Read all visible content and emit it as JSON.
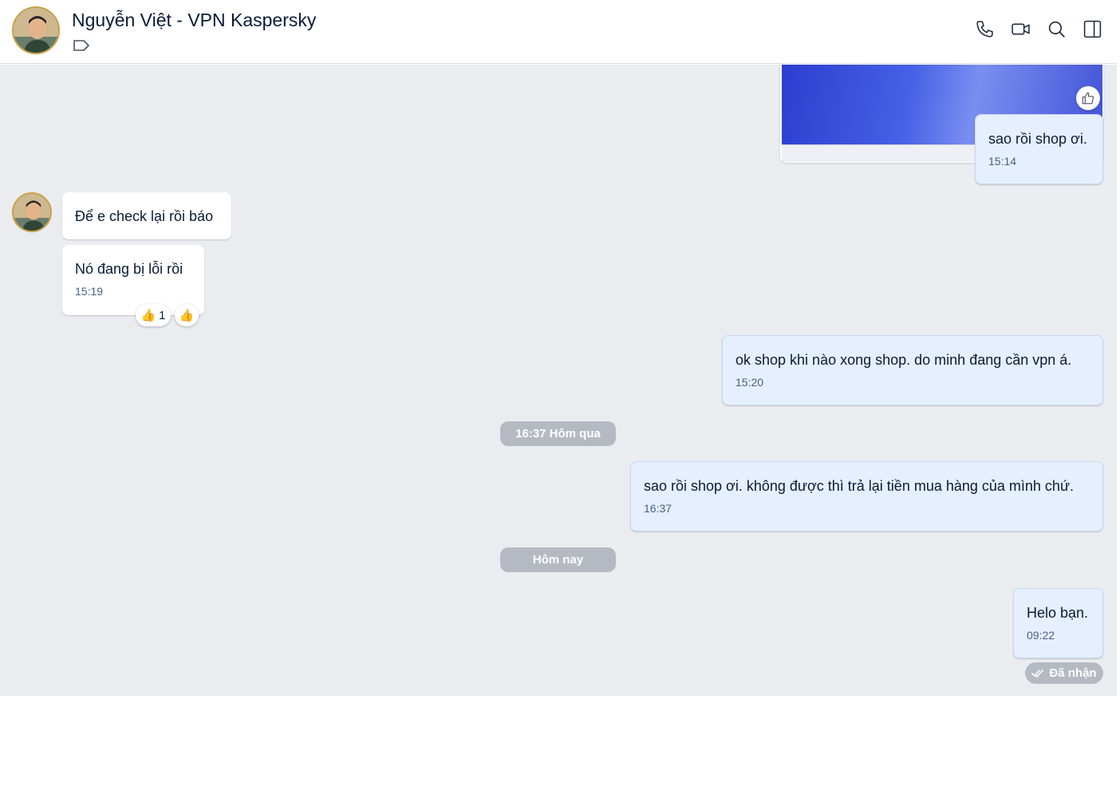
{
  "header": {
    "contact_name": "Nguyễn Việt - VPN Kaspersky",
    "icons": [
      "tag-icon",
      "phone-icon",
      "video-call-icon",
      "search-icon",
      "sidebar-toggle-icon"
    ]
  },
  "messages": [
    {
      "from": "me",
      "type": "image",
      "reaction_icon": "thumbs-up-icon"
    },
    {
      "from": "me",
      "text": "sao rồi shop ơi.",
      "time": "15:14"
    },
    {
      "from": "them",
      "text": "Để e check lại rồi báo"
    },
    {
      "from": "them",
      "text": "Nó đang bị lỗi rồi",
      "time": "15:19",
      "reactions": {
        "emoji": "👍",
        "count": "1",
        "quick": "👍"
      }
    },
    {
      "from": "me",
      "text": "ok shop khi nào  xong shop. do minh đang cần vpn á.",
      "time": "15:20"
    },
    {
      "from": "me",
      "text": "sao rồi shop ơi. không được thì trả lại tiền mua hàng của mình chứ.",
      "time": "16:37"
    },
    {
      "from": "me",
      "text": "Helo bạn.",
      "time": "09:22",
      "status": "Đã nhận"
    }
  ],
  "dividers": [
    "16:37 Hôm qua",
    "Hôm nay"
  ],
  "colors": {
    "my_bubble": "#e5efff",
    "their_bubble": "#ffffff",
    "chat_bg": "#eaecf0",
    "divider": "#b5bac2"
  }
}
